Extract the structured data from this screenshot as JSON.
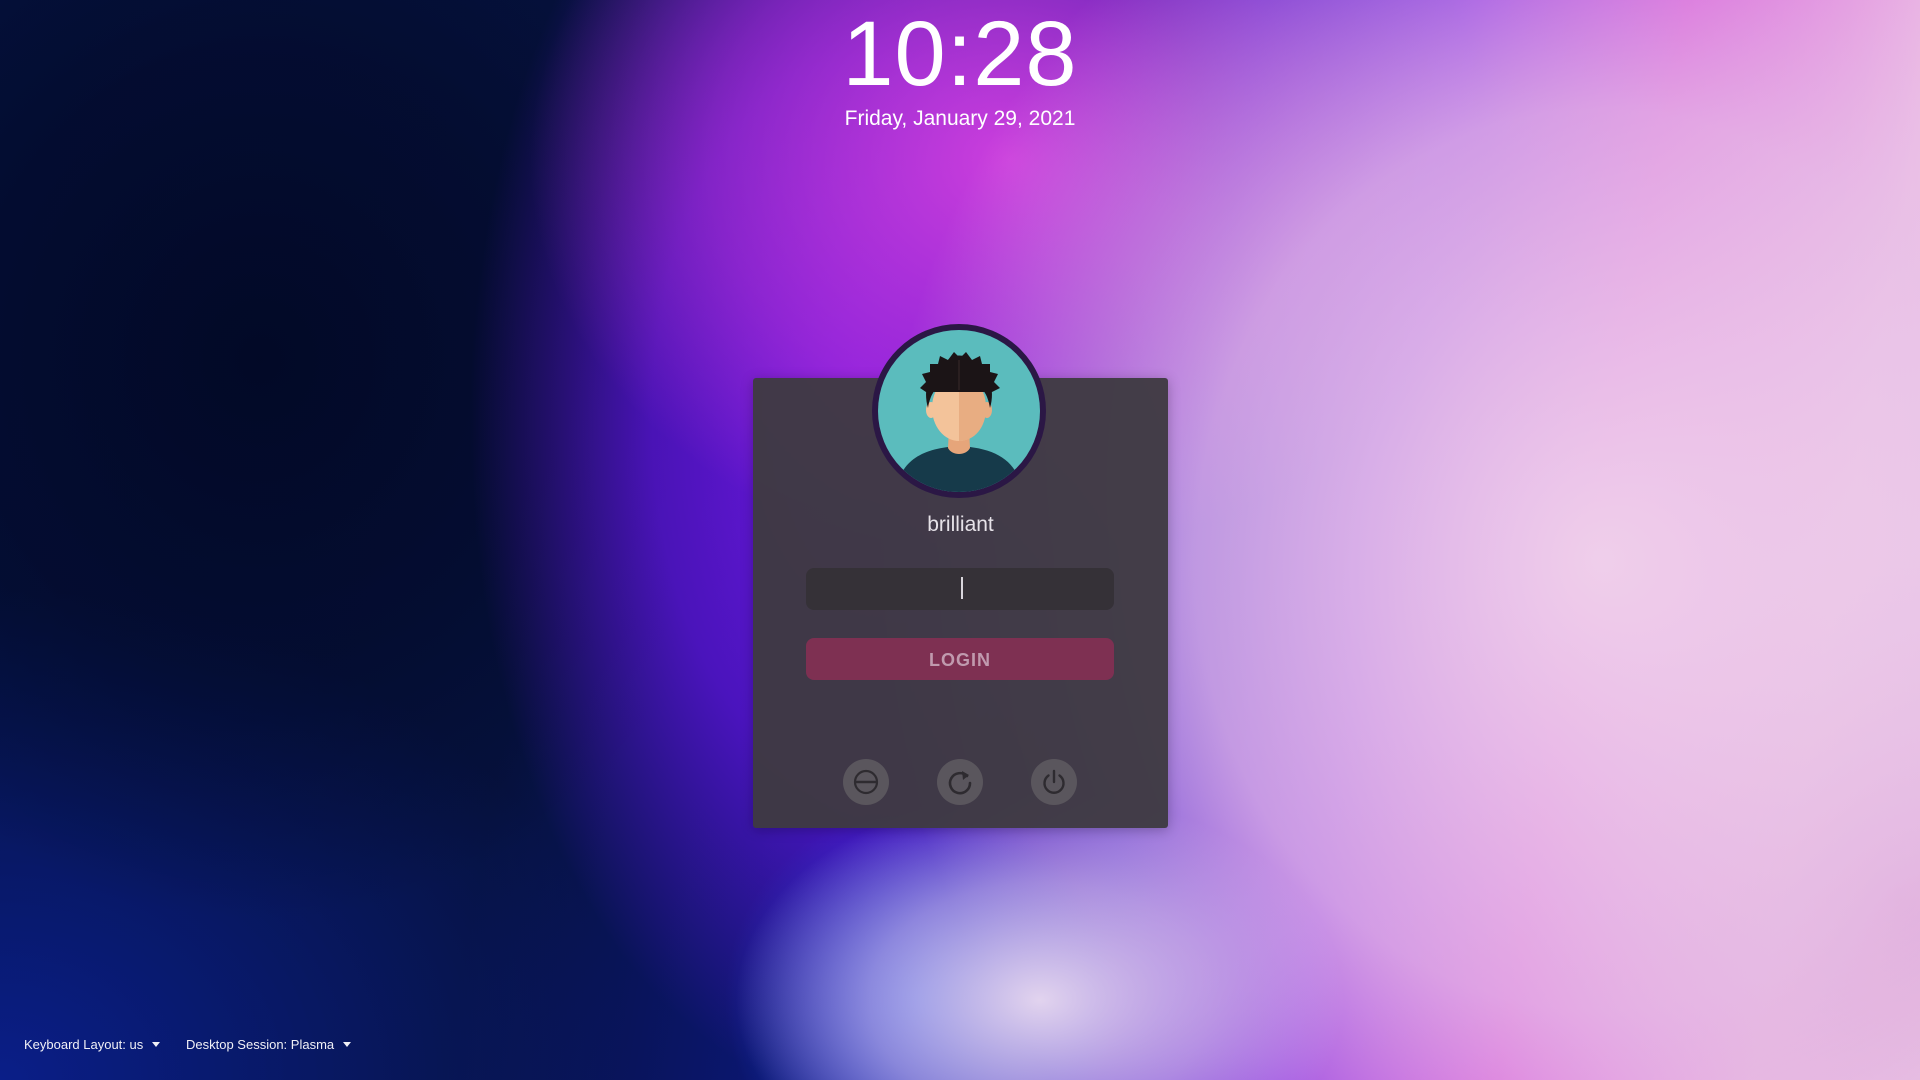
{
  "clock": {
    "time": "10:28",
    "date": "Friday, January 29, 2021"
  },
  "login": {
    "username": "brilliant",
    "password_value": "",
    "login_label": "LOGIN",
    "avatar_icon": "user-avatar-icon"
  },
  "power_actions": [
    {
      "name": "suspend",
      "icon": "suspend-icon"
    },
    {
      "name": "reboot",
      "icon": "reboot-icon"
    },
    {
      "name": "shutdown",
      "icon": "power-icon"
    }
  ],
  "bottom_bar": {
    "keyboard_layout": "Keyboard Layout: us",
    "desktop_session": "Desktop Session: Plasma"
  },
  "colors": {
    "card_bg": "#3e3a42",
    "login_button": "#7e3052",
    "login_text": "#c09aae",
    "avatar_bg": "#5bbcbd",
    "avatar_ring": "#2b1745"
  }
}
